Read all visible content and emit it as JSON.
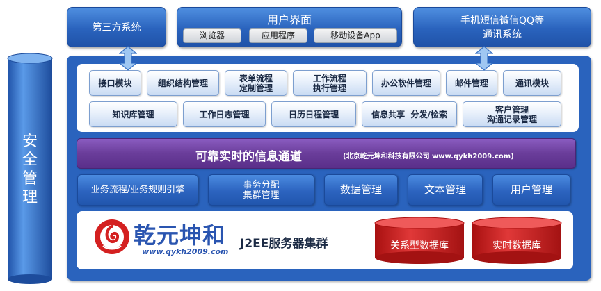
{
  "top": {
    "third_party": "第三方系统",
    "user_interface": "用户界面",
    "ui_items": [
      "浏览器",
      "应用程序",
      "移动设备App"
    ],
    "messaging_line1": "手机短信微信QQ等",
    "messaging_line2": "通讯系统"
  },
  "security": "安全管理",
  "modules_row1": [
    {
      "l1": "接口模块",
      "l2": ""
    },
    {
      "l1": "组织结构管理",
      "l2": ""
    },
    {
      "l1": "表单流程",
      "l2": "定制管理"
    },
    {
      "l1": "工作流程",
      "l2": "执行管理"
    },
    {
      "l1": "办公软件管理",
      "l2": ""
    },
    {
      "l1": "邮件管理",
      "l2": ""
    },
    {
      "l1": "通讯模块",
      "l2": ""
    }
  ],
  "modules_row2": [
    {
      "l1": "知识库管理",
      "l2": ""
    },
    {
      "l1": "工作日志管理",
      "l2": ""
    },
    {
      "l1": "日历日程管理",
      "l2": ""
    },
    {
      "l1": "信息共享  分发/检索",
      "l2": ""
    },
    {
      "l1": "客户管理",
      "l2": "沟通记录管理"
    }
  ],
  "channel": {
    "title": "可靠实时的信息通道",
    "subtitle": "(北京乾元坤和科技有限公司 www.qykh2009.com)"
  },
  "services": [
    {
      "l1": "业务流程/业务规则引擎",
      "l2": ""
    },
    {
      "l1": "事务分配",
      "l2": "集群管理"
    },
    {
      "l1": "数据管理",
      "l2": ""
    },
    {
      "l1": "文本管理",
      "l2": ""
    },
    {
      "l1": "用户管理",
      "l2": ""
    }
  ],
  "bottom": {
    "brand": "乾元坤和",
    "brand_url": "www.qykh2009.com",
    "server": "J2EE服务器集群",
    "db1": "关系型数据库",
    "db2": "实时数据库"
  },
  "colors": {
    "accent_blue": "#2a63bd",
    "purple": "#6a3d9a",
    "red": "#d42020"
  }
}
